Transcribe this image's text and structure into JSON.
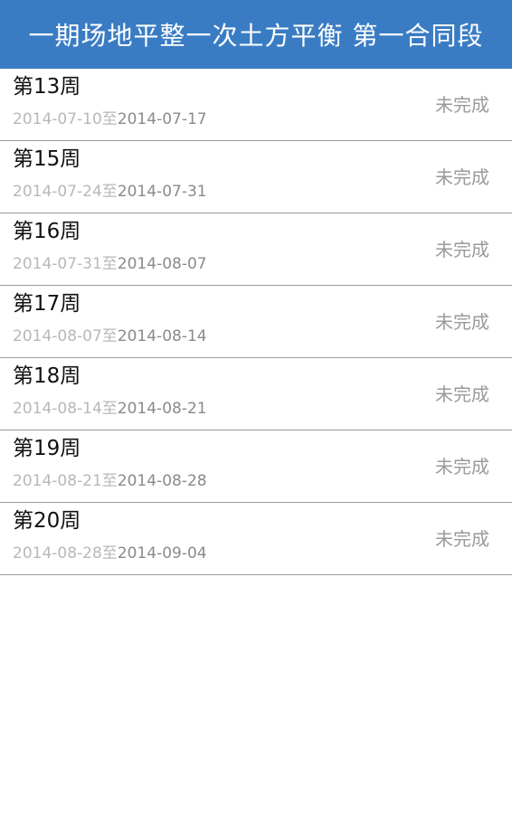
{
  "header": {
    "title": "一期场地平整一次土方平衡 第一合同段"
  },
  "weeks": [
    {
      "label": "第13周",
      "start": "2014-07-10",
      "sep": "至",
      "end": "2014-07-17",
      "status": "未完成"
    },
    {
      "label": "第15周",
      "start": "2014-07-24",
      "sep": "至",
      "end": "2014-07-31",
      "status": "未完成"
    },
    {
      "label": "第16周",
      "start": "2014-07-31",
      "sep": "至",
      "end": "2014-08-07",
      "status": "未完成"
    },
    {
      "label": "第17周",
      "start": "2014-08-07",
      "sep": "至",
      "end": "2014-08-14",
      "status": "未完成"
    },
    {
      "label": "第18周",
      "start": "2014-08-14",
      "sep": "至",
      "end": "2014-08-21",
      "status": "未完成"
    },
    {
      "label": "第19周",
      "start": "2014-08-21",
      "sep": "至",
      "end": "2014-08-28",
      "status": "未完成"
    },
    {
      "label": "第20周",
      "start": "2014-08-28",
      "sep": "至",
      "end": "2014-09-04",
      "status": "未完成"
    }
  ],
  "colors": {
    "header_bg": "#3a7cc4",
    "header_text": "#ffffff",
    "status_text": "#9a9a9a"
  }
}
